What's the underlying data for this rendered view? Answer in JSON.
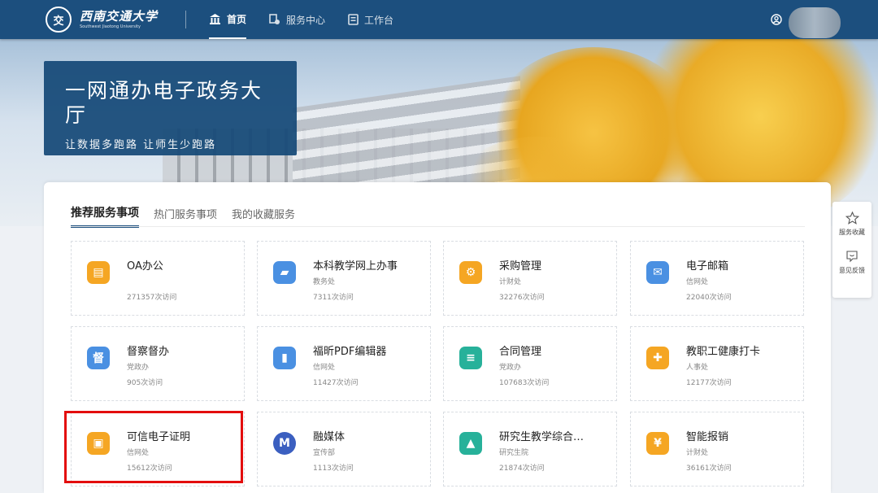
{
  "header": {
    "logo_seal": "交",
    "logo_cn": "西南交通大学",
    "logo_en": "Southwest Jiaotong University",
    "nav": [
      {
        "label": "首页",
        "icon": "home-icon"
      },
      {
        "label": "服务中心",
        "icon": "service-icon"
      },
      {
        "label": "工作台",
        "icon": "workbench-icon"
      }
    ]
  },
  "hero": {
    "title": "一网通办电子政务大厅",
    "subtitle": "让数据多跑路 让师生少跑路"
  },
  "tabs": [
    "推荐服务事项",
    "热门服务事项",
    "我的收藏服务"
  ],
  "services": [
    {
      "name": "OA办公",
      "dept": "",
      "visits": "271357次访问",
      "icon": "oa-icon",
      "color": "#f5a623"
    },
    {
      "name": "本科教学网上办事",
      "dept": "教务处",
      "visits": "7311次访问",
      "icon": "folder-icon",
      "color": "#4a90e2"
    },
    {
      "name": "采购管理",
      "dept": "计财处",
      "visits": "32276次访问",
      "icon": "procurement-icon",
      "color": "#f5a623"
    },
    {
      "name": "电子邮箱",
      "dept": "信网处",
      "visits": "22040次访问",
      "icon": "mail-icon",
      "color": "#4a90e2"
    },
    {
      "name": "督察督办",
      "dept": "党政办",
      "visits": "905次访问",
      "icon": "supervision-icon",
      "color": "#4a90e2"
    },
    {
      "name": "福昕PDF编辑器",
      "dept": "信网处",
      "visits": "11427次访问",
      "icon": "pdf-icon",
      "color": "#4a90e2"
    },
    {
      "name": "合同管理",
      "dept": "党政办",
      "visits": "107683次访问",
      "icon": "contract-icon",
      "color": "#27b19a"
    },
    {
      "name": "教职工健康打卡",
      "dept": "人事处",
      "visits": "12177次访问",
      "icon": "health-icon",
      "color": "#f5a623"
    },
    {
      "name": "可信电子证明",
      "dept": "信网处",
      "visits": "15612次访问",
      "icon": "certificate-icon",
      "color": "#f5a623"
    },
    {
      "name": "融媒体",
      "dept": "宣传部",
      "visits": "1113次访问",
      "icon": "media-icon",
      "color": "#3b5fc0"
    },
    {
      "name": "研究生教学综合…",
      "dept": "研究生院",
      "visits": "21874次访问",
      "icon": "graduate-icon",
      "color": "#27b19a"
    },
    {
      "name": "智能报销",
      "dept": "计财处",
      "visits": "36161次访问",
      "icon": "reimburse-icon",
      "color": "#f5a623"
    }
  ],
  "float_bar": [
    {
      "label": "服务收藏",
      "icon": "star-icon"
    },
    {
      "label": "意见反馈",
      "icon": "feedback-icon"
    }
  ],
  "highlight_color": "#e30d0d",
  "accent_color": "#1c4f7e"
}
